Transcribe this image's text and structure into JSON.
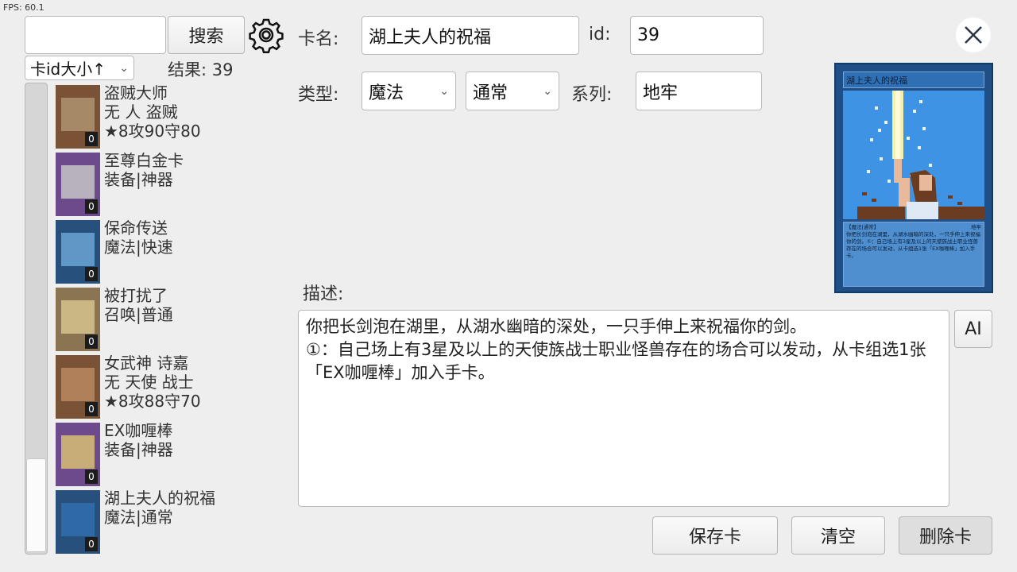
{
  "fps": "FPS: 60.1",
  "search": {
    "value": "",
    "button_label": "搜索"
  },
  "sort": {
    "selected": "卡id大小↑"
  },
  "results": {
    "label": "结果: 39"
  },
  "card_list": [
    {
      "name": "盗贼大师",
      "line2": "无 人 盗贼",
      "line3": "★8攻90守80",
      "count": "0",
      "frame": "#7a5236",
      "art": "#a68a68"
    },
    {
      "name": "至尊白金卡",
      "line2": "装备|神器",
      "line3": "",
      "count": "0",
      "frame": "#6c4a8c",
      "art": "#b7b2bd"
    },
    {
      "name": "保命传送",
      "line2": "魔法|快速",
      "line3": "",
      "count": "0",
      "frame": "#28507c",
      "art": "#5f98c7"
    },
    {
      "name": "被打扰了",
      "line2": "召唤|普通",
      "line3": "",
      "count": "0",
      "frame": "#8a7452",
      "art": "#cbb784"
    },
    {
      "name": "女武神 诗嘉",
      "line2": "无 天使 战士",
      "line3": "★8攻88守70",
      "count": "0",
      "frame": "#7a5236",
      "art": "#b0805a"
    },
    {
      "name": "EX咖喱棒",
      "line2": "装备|神器",
      "line3": "",
      "count": "0",
      "frame": "#6c4a8c",
      "art": "#c8ad78"
    },
    {
      "name": "湖上夫人的祝福",
      "line2": "魔法|通常",
      "line3": "",
      "count": "0",
      "frame": "#28507c",
      "art": "#2f6aa6"
    }
  ],
  "form": {
    "name_label": "卡名:",
    "name_value": "湖上夫人的祝福",
    "id_label": "id:",
    "id_value": "39",
    "type_label": "类型:",
    "type_value": "魔法",
    "subtype_value": "通常",
    "series_label": "系列:",
    "series_value": "地牢",
    "desc_label": "描述:",
    "desc_value": "你把长剑泡在湖里，从湖水幽暗的深处，一只手伸上来祝福你的剑。\n①：自己场上有3星及以上的天使族战士职业怪兽存在的场合可以发动，从卡组选1张「EX咖喱棒」加入手卡。",
    "ai_label": "AI"
  },
  "preview": {
    "title": "湖上夫人的祝福",
    "type_tag": "【魔法|通常】",
    "corner": "地牢",
    "text": "你把长剑泡在湖里，从湖水幽暗的深处，一只手伸上来祝福你的剑。①：自己场上有3星及以上的天使族战士职业怪兽存在的场合可以发动，从卡组选1张「EX咖喱棒」加入手卡。"
  },
  "actions": {
    "save": "保存卡",
    "clear": "清空",
    "delete": "删除卡"
  },
  "icons": {
    "settings": "gear-icon",
    "close": "close-icon"
  }
}
